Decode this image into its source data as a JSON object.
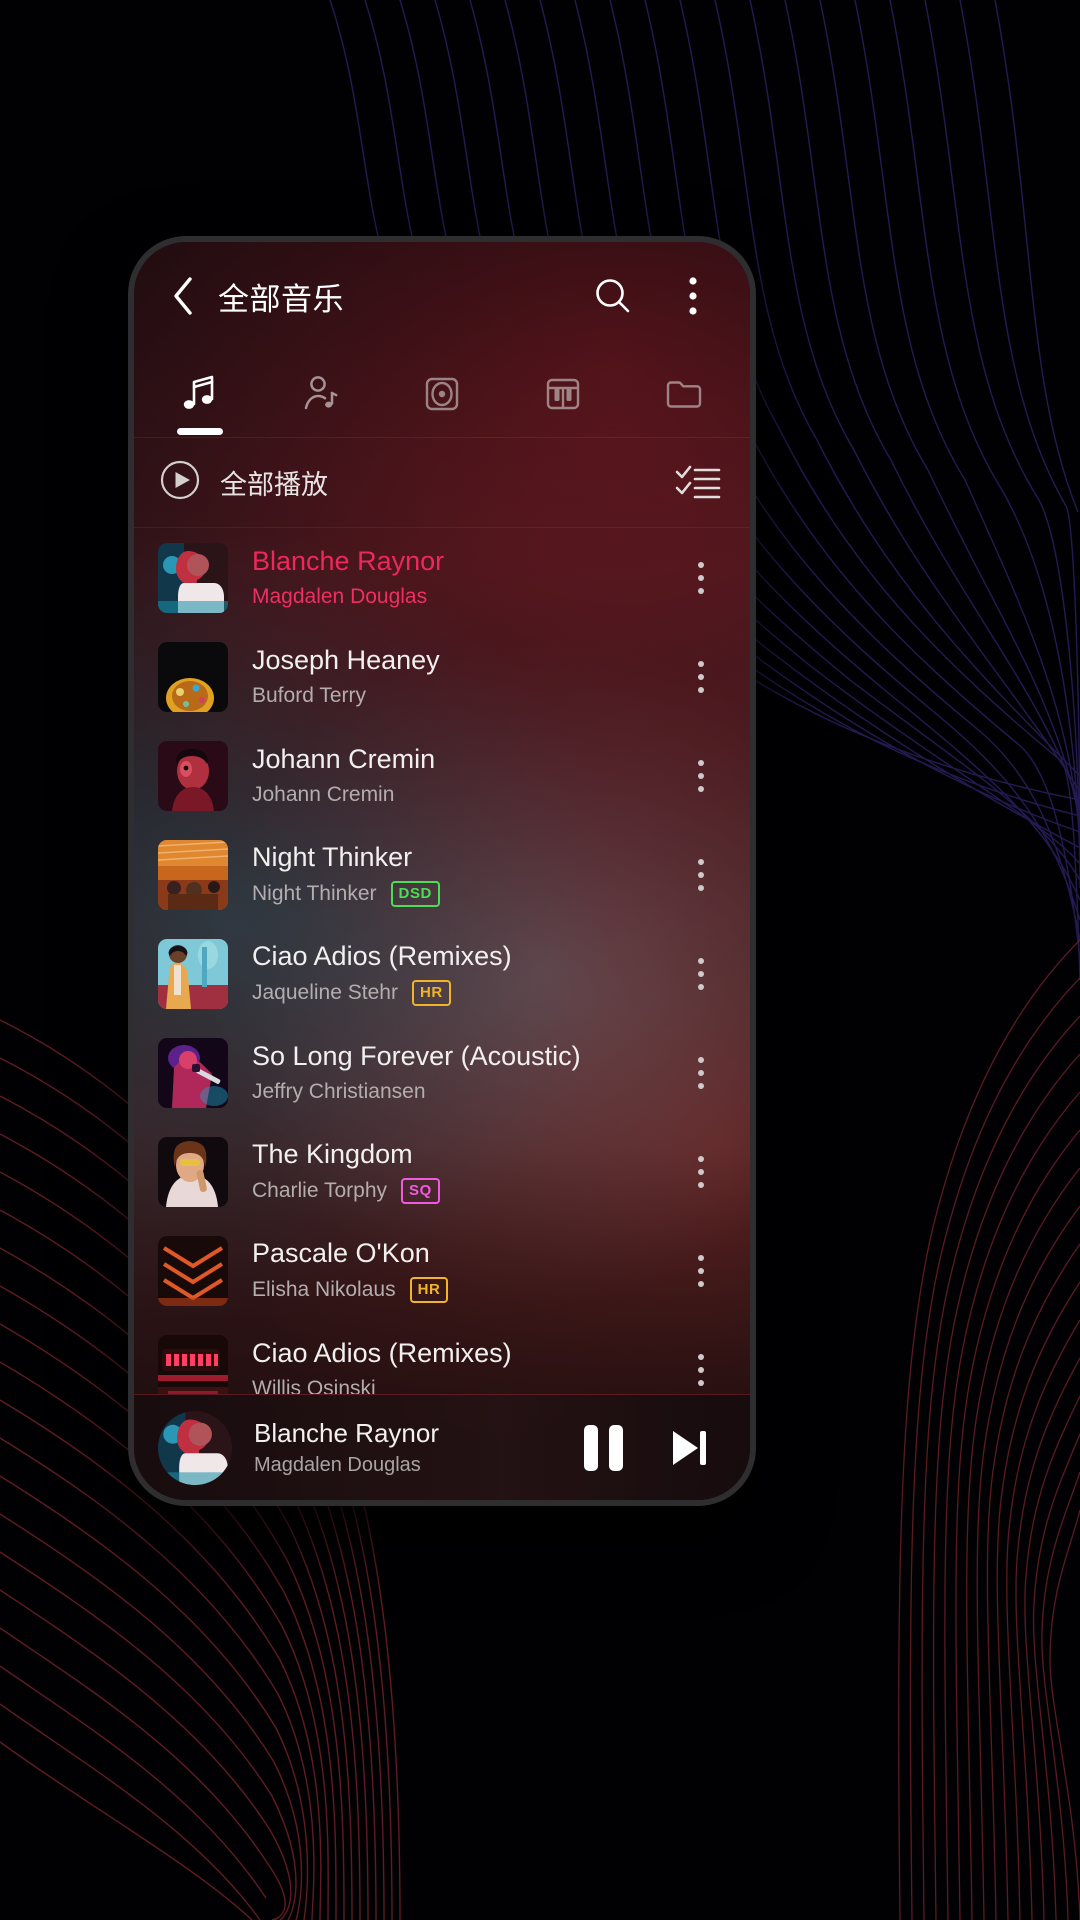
{
  "app": {
    "header": {
      "back_icon": "chevron-left-icon",
      "title": "全部音乐",
      "search_icon": "search-icon",
      "overflow_icon": "more-vertical-icon"
    },
    "tabs": [
      {
        "icon": "music-note-icon",
        "name": "songs",
        "active": true
      },
      {
        "icon": "artist-icon",
        "name": "artists",
        "active": false
      },
      {
        "icon": "album-disc-icon",
        "name": "albums",
        "active": false
      },
      {
        "icon": "piano-keys-icon",
        "name": "genres",
        "active": false
      },
      {
        "icon": "folder-icon",
        "name": "folders",
        "active": false
      }
    ],
    "play_all": {
      "play_icon": "play-circle-icon",
      "label": "全部播放",
      "multiselect_icon": "checklist-icon"
    },
    "songs": [
      {
        "title": "Blanche Raynor",
        "artist": "Magdalen Douglas",
        "badge": "",
        "playing": true
      },
      {
        "title": "Joseph Heaney",
        "artist": "Buford Terry",
        "badge": "",
        "playing": false
      },
      {
        "title": "Johann Cremin",
        "artist": "Johann Cremin",
        "badge": "",
        "playing": false
      },
      {
        "title": "Night Thinker",
        "artist": "Night Thinker",
        "badge": "DSD",
        "playing": false
      },
      {
        "title": "Ciao Adios (Remixes)",
        "artist": "Jaqueline Stehr",
        "badge": "HR",
        "playing": false
      },
      {
        "title": "So Long Forever (Acoustic)",
        "artist": "Jeffry Christiansen",
        "badge": "",
        "playing": false
      },
      {
        "title": "The Kingdom",
        "artist": "Charlie Torphy",
        "badge": "SQ",
        "playing": false
      },
      {
        "title": "Pascale O'Kon",
        "artist": "Elisha Nikolaus",
        "badge": "HR",
        "playing": false
      },
      {
        "title": "Ciao Adios (Remixes)",
        "artist": "Willis Osinski",
        "badge": "",
        "playing": false
      }
    ],
    "now_playing": {
      "title": "Blanche Raynor",
      "artist": "Magdalen Douglas",
      "pause_icon": "pause-icon",
      "next_icon": "skip-next-icon"
    },
    "colors": {
      "accent": "#f0275c",
      "badge_dsd": "#4ade55",
      "badge_hr": "#f0b429",
      "badge_sq": "#f05ae0",
      "title_text": "#f2efef",
      "artist_text": "#b3adae"
    }
  }
}
